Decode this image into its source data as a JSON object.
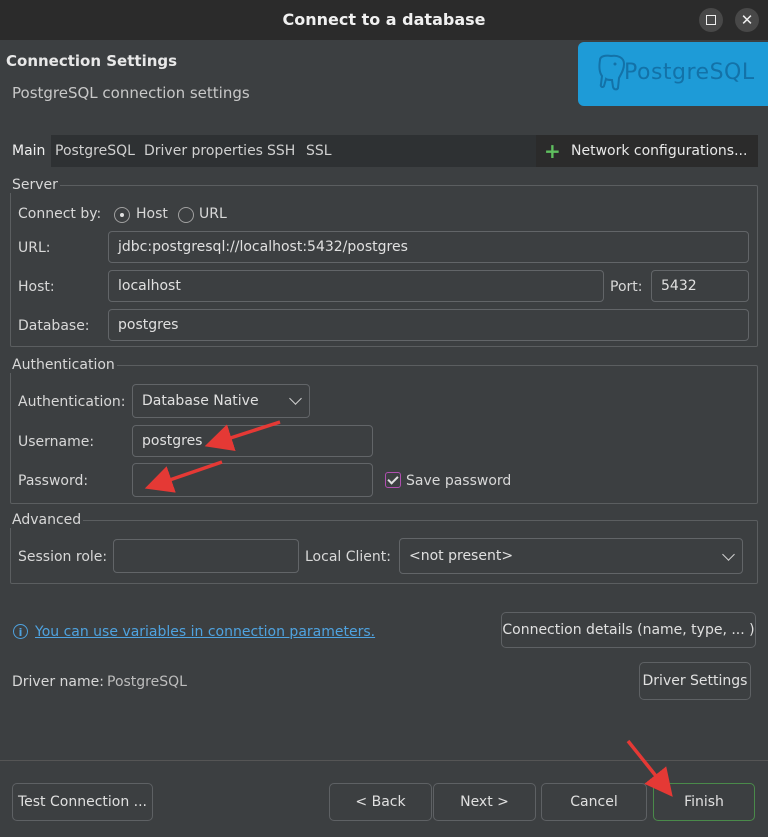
{
  "window": {
    "title": "Connect to a database",
    "maximize_icon": "maximize-icon",
    "close_glyph": "✕"
  },
  "header": {
    "title": "Connection Settings",
    "subtitle": "PostgreSQL connection settings",
    "logo_text": "PostgreSQL",
    "logo_color": "#1e9bd7"
  },
  "tabs": [
    "Main",
    "PostgreSQL",
    "Driver properties",
    "SSH",
    "SSL"
  ],
  "network_config": {
    "label": "Network configurations..."
  },
  "server": {
    "group_label": "Server",
    "connect_by_label": "Connect by:",
    "host_option": "Host",
    "url_option": "URL",
    "selected": "Host",
    "url_label": "URL:",
    "url_value": "jdbc:postgresql://localhost:5432/postgres",
    "host_label": "Host:",
    "host_value": "localhost",
    "port_label": "Port:",
    "port_value": "5432",
    "database_label": "Database:",
    "database_value": "postgres"
  },
  "authentication": {
    "group_label": "Authentication",
    "auth_label": "Authentication:",
    "auth_value": "Database Native",
    "username_label": "Username:",
    "username_value": "postgres",
    "password_label": "Password:",
    "password_value": "",
    "save_password_label": "Save password",
    "save_password_checked": true
  },
  "advanced": {
    "group_label": "Advanced",
    "session_role_label": "Session role:",
    "session_role_value": "",
    "local_client_label": "Local Client:",
    "local_client_value": "<not present>"
  },
  "info": {
    "link_text": "You can use variables in connection parameters.",
    "connection_details_button": "Connection details (name, type, ... )",
    "driver_name_label": "Driver name:",
    "driver_name_value": "PostgreSQL",
    "driver_settings_button": "Driver Settings"
  },
  "footer": {
    "test_connection": "Test Connection ...",
    "back": "< Back",
    "next": "Next >",
    "cancel": "Cancel",
    "finish": "Finish"
  },
  "annotation_color": "#e53935"
}
